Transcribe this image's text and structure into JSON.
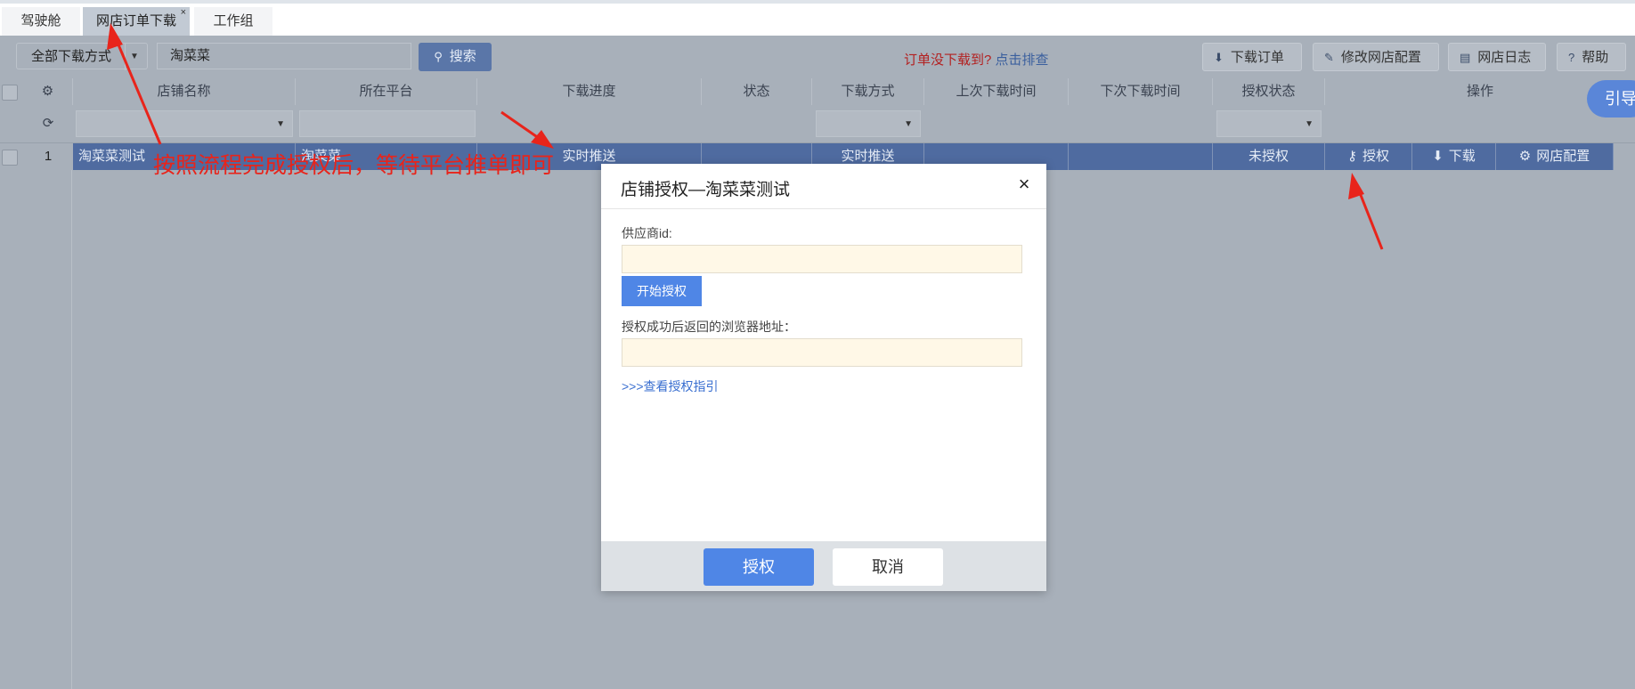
{
  "tabs": [
    {
      "label": "驾驶舱"
    },
    {
      "label": "网店订单下载",
      "close": "×"
    },
    {
      "label": "工作组"
    }
  ],
  "toolbar": {
    "download_mode": "全部下载方式",
    "search_value": "淘菜菜",
    "search_label": "搜索",
    "notice_red": "订单没下载到?",
    "notice_link": "点击排查",
    "download_orders": "下载订单",
    "modify_config": "修改网店配置",
    "shop_log": "网店日志",
    "help": "帮助",
    "guide": "引导"
  },
  "table": {
    "headers": [
      "店铺名称",
      "所在平台",
      "下载进度",
      "状态",
      "下载方式",
      "上次下载时间",
      "下次下载时间",
      "授权状态",
      "操作"
    ],
    "rows": [
      {
        "index": "1",
        "shop_name": "淘菜菜测试",
        "platform": "淘菜菜",
        "progress": "实时推送",
        "status": "",
        "download_mode": "实时推送",
        "last_time": "",
        "next_time": "",
        "auth_status": "未授权",
        "actions": {
          "authorize": "授权",
          "download": "下载",
          "config": "网店配置"
        }
      }
    ]
  },
  "annotation": {
    "text": "按照流程完成授权后，等待平台推单即可",
    "color": "#e8241b"
  },
  "modal": {
    "title": "店铺授权—淘菜菜测试",
    "close": "×",
    "supplier_label": "供应商id:",
    "supplier_value": "",
    "start_label": "开始授权",
    "return_label": "授权成功后返回的浏览器地址：",
    "return_value": "",
    "guide_link": ">>>查看授权指引",
    "ok": "授权",
    "cancel": "取消"
  },
  "colors": {
    "accent": "#4f86e6",
    "row_selected": "#4f6ba0",
    "input_bg": "#fff8e7"
  }
}
